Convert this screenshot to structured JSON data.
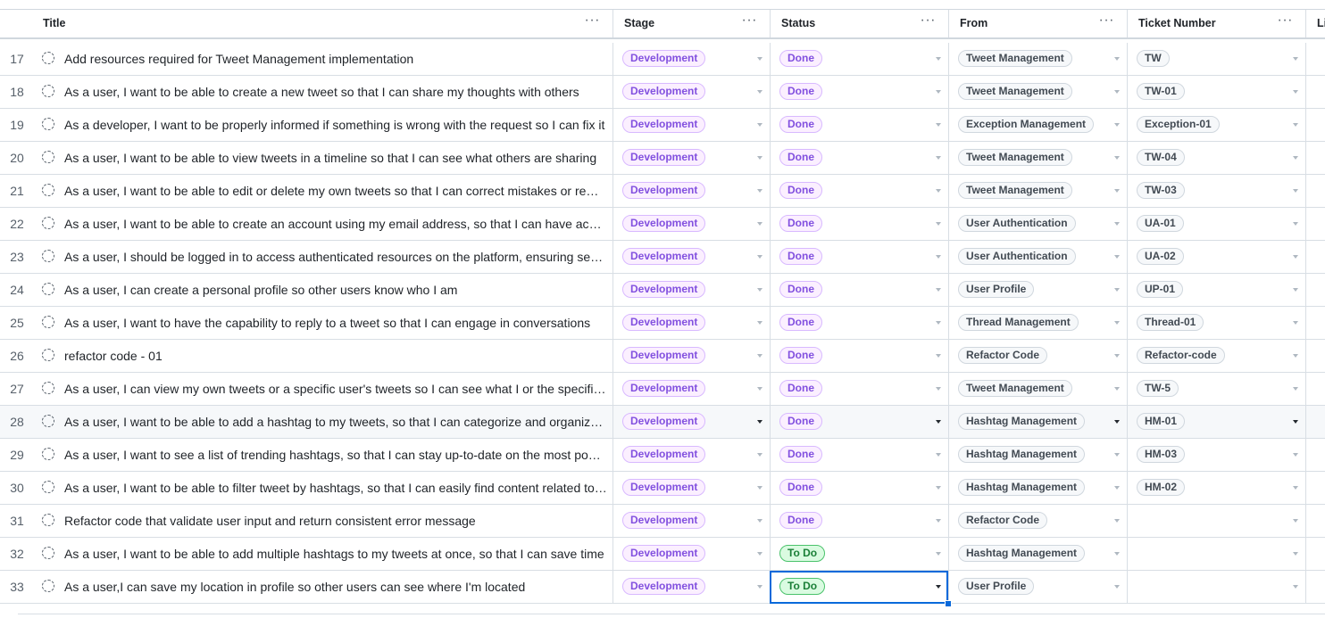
{
  "columns": [
    {
      "label": "Title",
      "menu": "···"
    },
    {
      "label": "Stage",
      "menu": "···"
    },
    {
      "label": "Status",
      "menu": "···"
    },
    {
      "label": "From",
      "menu": "···"
    },
    {
      "label": "Ticket Number",
      "menu": "···"
    },
    {
      "label": "Li",
      "menu": ""
    }
  ],
  "rows": [
    {
      "num": "17",
      "title": "Add resources required for Tweet Management implementation",
      "stage": "Development",
      "status": "Done",
      "from": "Tweet Management",
      "ticket": "TW"
    },
    {
      "num": "18",
      "title": "As a user, I want to be able to create a new tweet so that I can share my thoughts with others",
      "stage": "Development",
      "status": "Done",
      "from": "Tweet Management",
      "ticket": "TW-01"
    },
    {
      "num": "19",
      "title": "As a developer, I want to be properly informed if something is wrong with the request so I can fix it",
      "stage": "Development",
      "status": "Done",
      "from": "Exception Management",
      "ticket": "Exception-01"
    },
    {
      "num": "20",
      "title": "As a user, I want to be able to view tweets in a timeline so that I can see what others are sharing",
      "stage": "Development",
      "status": "Done",
      "from": "Tweet Management",
      "ticket": "TW-04"
    },
    {
      "num": "21",
      "title": "As a user, I want to be able to edit or delete my own tweets so that I can correct mistakes or remove content",
      "stage": "Development",
      "status": "Done",
      "from": "Tweet Management",
      "ticket": "TW-03"
    },
    {
      "num": "22",
      "title": "As a user, I want to be able to create an account using my email address, so that I can have access",
      "stage": "Development",
      "status": "Done",
      "from": "User Authentication",
      "ticket": "UA-01"
    },
    {
      "num": "23",
      "title": "As a user, I should be logged in to access authenticated resources on the platform, ensuring security",
      "stage": "Development",
      "status": "Done",
      "from": "User Authentication",
      "ticket": "UA-02"
    },
    {
      "num": "24",
      "title": "As a user, I can create a personal profile so other users know who I am",
      "stage": "Development",
      "status": "Done",
      "from": "User Profile",
      "ticket": "UP-01"
    },
    {
      "num": "25",
      "title": "As a user, I want to have the capability to reply to a tweet so that I can engage in conversations",
      "stage": "Development",
      "status": "Done",
      "from": "Thread Management",
      "ticket": "Thread-01"
    },
    {
      "num": "26",
      "title": "refactor code - 01",
      "stage": "Development",
      "status": "Done",
      "from": "Refactor Code",
      "ticket": "Refactor-code"
    },
    {
      "num": "27",
      "title": "As a user, I can view my own tweets or a specific user's tweets so I can see what I or the specific user posted",
      "stage": "Development",
      "status": "Done",
      "from": "Tweet Management",
      "ticket": "TW-5"
    },
    {
      "num": "28",
      "title": "As a user, I want to be able to add a hashtag to my tweets, so that I can categorize and organize them",
      "stage": "Development",
      "status": "Done",
      "from": "Hashtag Management",
      "ticket": "HM-01"
    },
    {
      "num": "29",
      "title": "As a user, I want to see a list of trending hashtags, so that I can stay up-to-date on the most popular topics",
      "stage": "Development",
      "status": "Done",
      "from": "Hashtag Management",
      "ticket": "HM-03"
    },
    {
      "num": "30",
      "title": "As a user, I want to be able to filter tweet by hashtags, so that I can easily find content related to a topic",
      "stage": "Development",
      "status": "Done",
      "from": "Hashtag Management",
      "ticket": "HM-02"
    },
    {
      "num": "31",
      "title": "Refactor code that validate user input and return consistent error message",
      "stage": "Development",
      "status": "Done",
      "from": "Refactor Code",
      "ticket": ""
    },
    {
      "num": "32",
      "title": "As a user, I want to be able to add multiple hashtags to my tweets at once, so that I can save time",
      "stage": "Development",
      "status": "To Do",
      "from": "Hashtag Management",
      "ticket": ""
    },
    {
      "num": "33",
      "title": "As a user,I can save my location in profile so other users can see where I'm located",
      "stage": "Development",
      "status": "To Do",
      "from": "User Profile",
      "ticket": ""
    }
  ],
  "hovered_row": "28",
  "selected_cell": {
    "row": "33",
    "column": "Status"
  },
  "colors": {
    "stage_pill": "#8250df",
    "done_pill": "#8250df",
    "todo_pill": "#1a7f37",
    "gray_pill": "#424a53",
    "selection": "#0969da",
    "border": "#d8dee4"
  },
  "icons": {
    "title_status": "dashed-circle-icon",
    "column_menu": "kebab-menu-icon",
    "dropdown": "caret-down-icon"
  }
}
